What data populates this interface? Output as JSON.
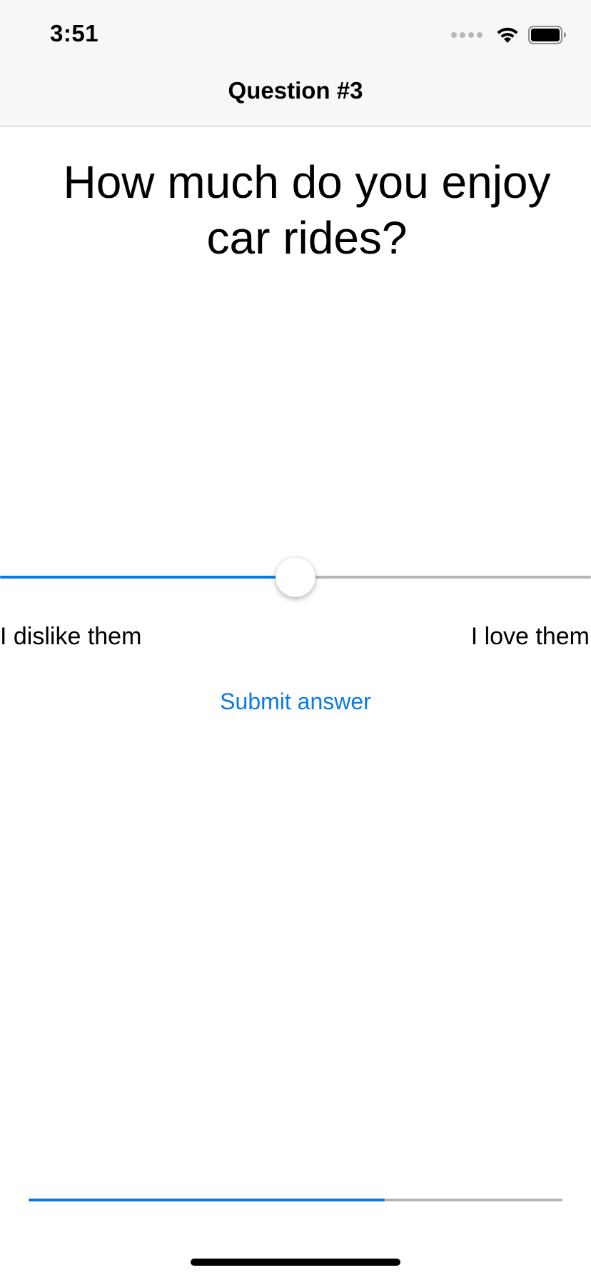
{
  "status_bar": {
    "time": "3:51",
    "icons": [
      "signal-icon",
      "wifi-icon",
      "battery-icon"
    ]
  },
  "nav": {
    "title": "Question #3"
  },
  "question": {
    "text": "How much do you enjoy car rides?"
  },
  "slider": {
    "value_fraction": 0.5,
    "min_label": "I dislike them",
    "max_label": "I love them"
  },
  "submit": {
    "label": "Submit answer"
  },
  "progress": {
    "value_fraction": 0.667
  },
  "colors": {
    "accent": "#0a7ae8",
    "track": "#b5b5b8",
    "bar_bg": "#f7f7f7"
  }
}
